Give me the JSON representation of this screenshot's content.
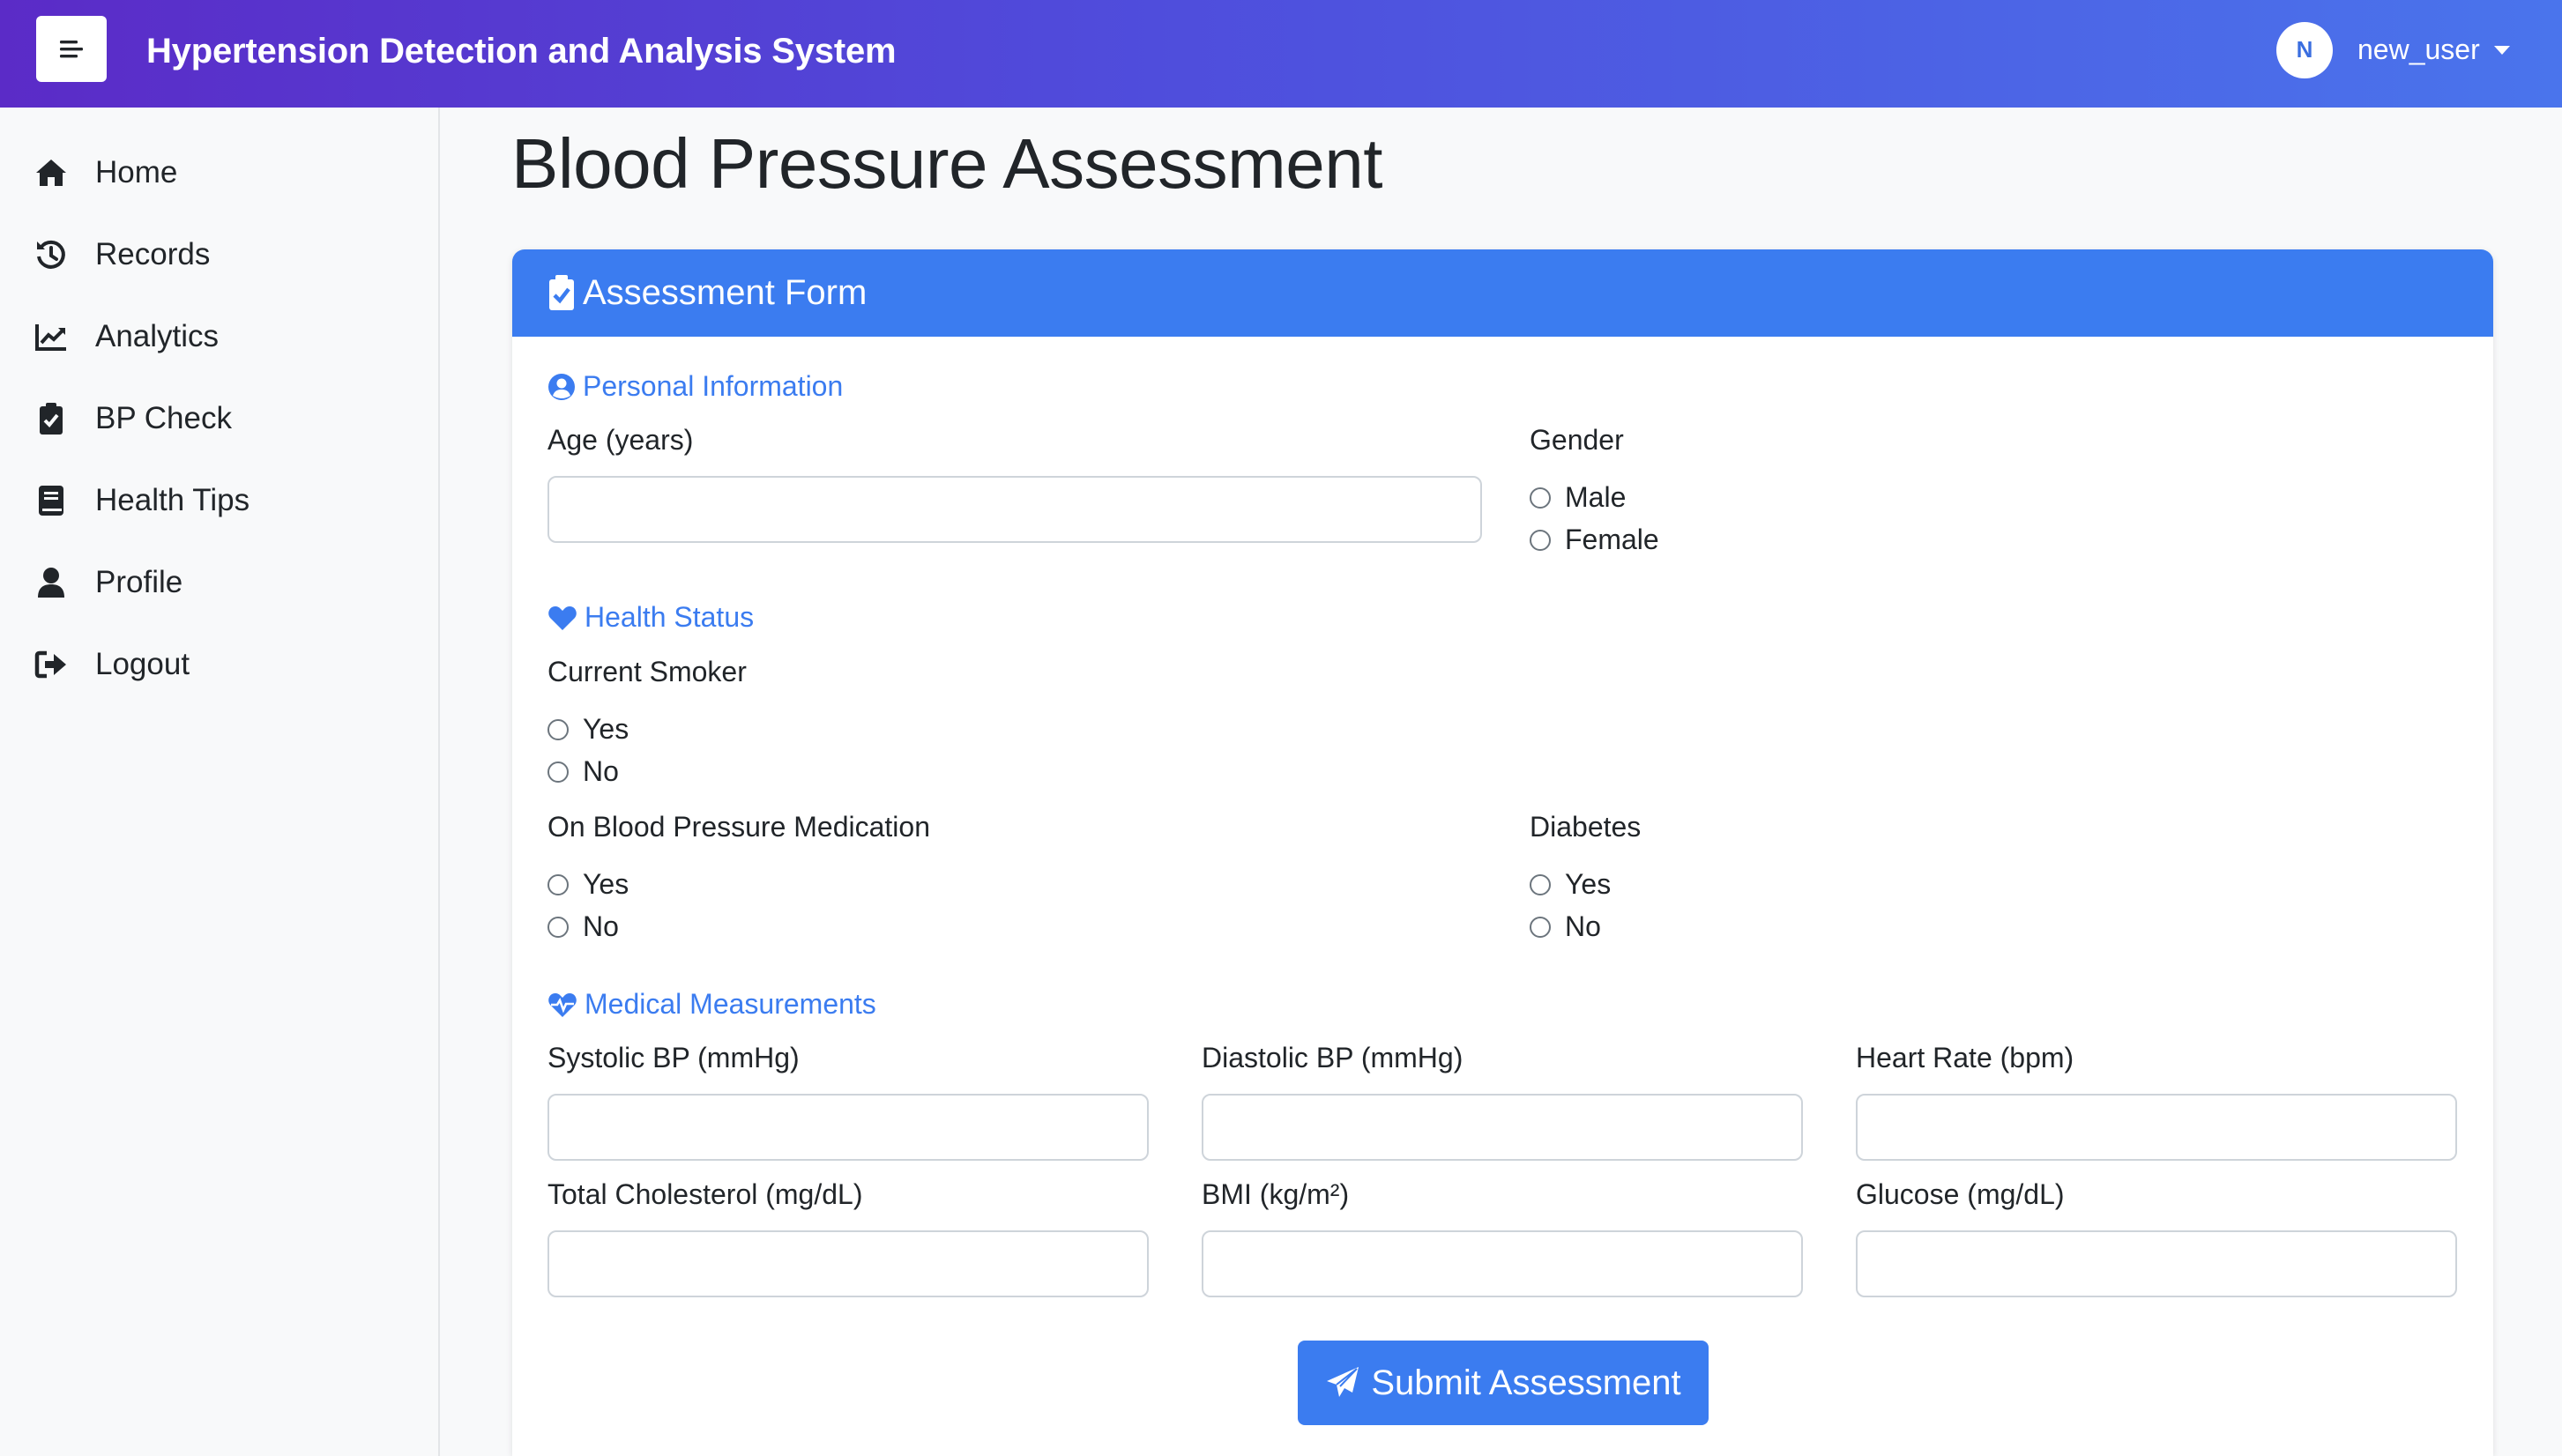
{
  "navbar": {
    "brand": "Hypertension Detection and Analysis System",
    "user_initial": "N",
    "username": "new_user",
    "icons": {
      "menu": "menu-lines-icon",
      "caret": "caret-down-icon"
    }
  },
  "sidebar": {
    "items": [
      {
        "label": "Home",
        "icon": "home-icon"
      },
      {
        "label": "Records",
        "icon": "history-icon"
      },
      {
        "label": "Analytics",
        "icon": "chart-line-icon"
      },
      {
        "label": "BP Check",
        "icon": "clipboard-check-icon"
      },
      {
        "label": "Health Tips",
        "icon": "book-icon"
      },
      {
        "label": "Profile",
        "icon": "user-icon"
      },
      {
        "label": "Logout",
        "icon": "sign-out-icon"
      }
    ]
  },
  "main": {
    "title": "Blood Pressure Assessment",
    "card_title": "Assessment Form",
    "personal": {
      "section": "Personal Information",
      "age_label": "Age (years)",
      "age_value": "",
      "gender_label": "Gender",
      "gender_options": [
        "Male",
        "Female"
      ]
    },
    "health": {
      "section": "Health Status",
      "smoker_label": "Current Smoker",
      "smoker_options": [
        "Yes",
        "No"
      ],
      "bpmeds_label": "On Blood Pressure Medication",
      "bpmeds_options": [
        "Yes",
        "No"
      ],
      "diabetes_label": "Diabetes",
      "diabetes_options": [
        "Yes",
        "No"
      ]
    },
    "medical": {
      "section": "Medical Measurements",
      "fields": [
        {
          "label": "Systolic BP (mmHg)",
          "value": ""
        },
        {
          "label": "Diastolic BP (mmHg)",
          "value": ""
        },
        {
          "label": "Heart Rate (bpm)",
          "value": ""
        },
        {
          "label": "Total Cholesterol (mg/dL)",
          "value": ""
        },
        {
          "label": "BMI (kg/m²)",
          "value": ""
        },
        {
          "label": "Glucose (mg/dL)",
          "value": ""
        }
      ]
    },
    "submit_label": "Submit Assessment"
  },
  "colors": {
    "nav_gradient_start": "#5b2bc7",
    "nav_gradient_end": "#4a74ec",
    "primary": "#3b7cf0",
    "sidebar_bg": "#f8f9fa"
  }
}
